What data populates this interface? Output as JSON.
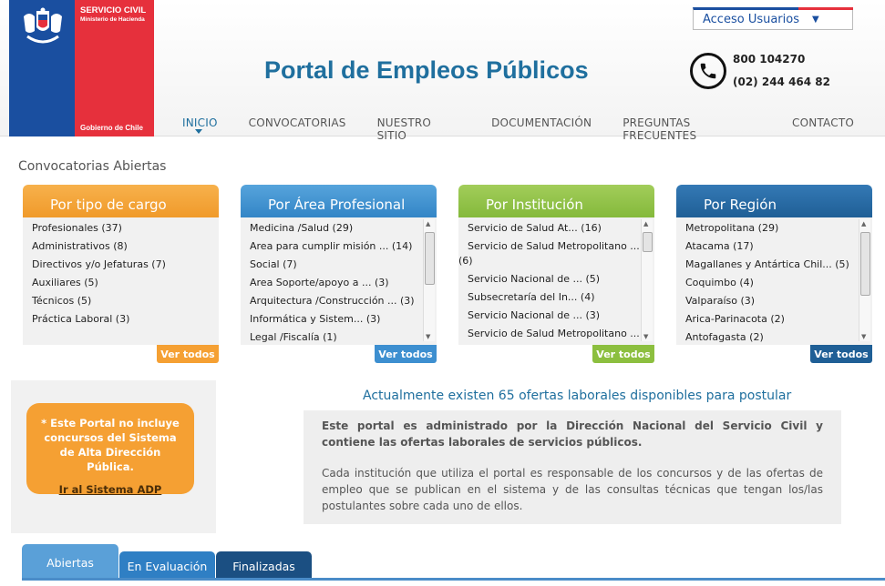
{
  "logo": {
    "line1": "SERVICIO CIVIL",
    "line2": "Ministerio de Hacienda",
    "line3": "Gobierno de Chile"
  },
  "header": {
    "title": "Portal de Empleos Públicos",
    "access_label": "Acceso Usuarios",
    "phone1": "800 104270",
    "phone2": "(02) 244 464 82"
  },
  "nav": {
    "items": [
      "INICIO",
      "CONVOCATORIAS",
      "NUESTRO SITIO",
      "DOCUMENTACIÓN",
      "PREGUNTAS FRECUENTES",
      "CONTACTO"
    ]
  },
  "section_title": "Convocatorias Abiertas",
  "panels": [
    {
      "title": "Por tipo de cargo",
      "items": [
        "Profesionales (37)",
        "Administrativos (8)",
        "Directivos y/o Jefaturas (7)",
        "Auxiliares (5)",
        "Técnicos (5)",
        "Práctica Laboral (3)"
      ],
      "button": "Ver todos"
    },
    {
      "title": "Por Área Profesional",
      "items": [
        "Medicina /Salud (29)",
        "Area para cumplir misión ... (14)",
        "Social (7)",
        "Area Soporte/apoyo a ... (3)",
        "Arquitectura /Construcción ... (3)",
        "Informática y Sistem... (3)",
        "Legal /Fiscalía (1)"
      ],
      "button": "Ver todos"
    },
    {
      "title": "Por Institución",
      "items": [
        "Servicio de Salud At... (16)",
        "Servicio de Salud Metropolitano ...",
        "(6)",
        "Servicio Nacional de ... (5)",
        "Subsecretaría del In... (4)",
        "Servicio Nacional de ... (3)",
        "Servicio de Salud Metropolitano ..."
      ],
      "button": "Ver todos"
    },
    {
      "title": "Por Región",
      "items": [
        "Metropolitana (29)",
        "Atacama (17)",
        "Magallanes y Antártica Chil... (5)",
        "Coquimbo (4)",
        "Valparaíso (3)",
        "Arica-Parinacota (2)",
        "Antofagasta (2)"
      ],
      "button": "Ver todos"
    }
  ],
  "adp": {
    "text": "* Este Portal no incluye concursos del Sistema de Alta Dirección Pública.",
    "link_prefix": "Ir al Sistema ",
    "link_bold": "ADP"
  },
  "offers_text": "Actualmente existen 65 ofertas laborales disponibles para postular",
  "info": {
    "p1": "Este portal es administrado por la Dirección Nacional del Servicio Civil y contiene las ofertas laborales de servicios públicos.",
    "p2": "Cada institución que utiliza el portal es responsable de los concursos y de las ofertas de empleo que se publican en el sistema y de las consultas técnicas que tengan los/las postulantes sobre cada uno de ellos."
  },
  "tabs": [
    "Abiertas",
    "En Evaluación",
    "Finalizadas"
  ],
  "colors": {
    "orange": "#f5a033",
    "blue": "#3d8fd0",
    "green": "#8cbf3f",
    "darkblue": "#1f5f96",
    "brand_blue": "#1a4fa0",
    "brand_red": "#e6303c"
  }
}
